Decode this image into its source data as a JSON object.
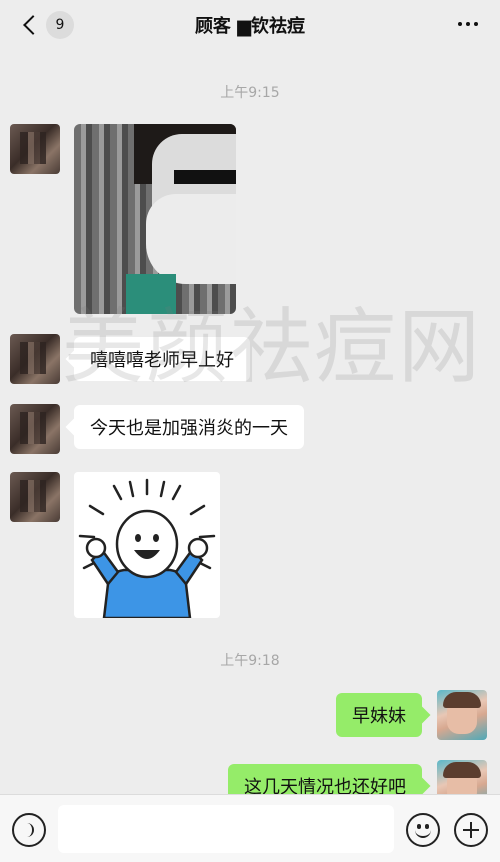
{
  "header": {
    "back_count": "9",
    "title": "顾客 ▆钦祛痘"
  },
  "messages": {
    "time1": "上午9:15",
    "msg1": "嘻嘻嘻老师早上好",
    "msg2": "今天也是加强消炎的一天",
    "time2": "上午9:18",
    "msg3": "早妹妹",
    "msg4": "这几天情况也还好吧"
  },
  "watermark": "美颜祛痘网",
  "icons": {
    "back": "chevron-left-icon",
    "more": "more-icon",
    "voice": "voice-icon",
    "emoji": "emoji-icon",
    "plus": "plus-icon"
  },
  "colors": {
    "background": "#ededed",
    "outgoing_bubble": "#95ec69",
    "incoming_bubble": "#ffffff"
  }
}
